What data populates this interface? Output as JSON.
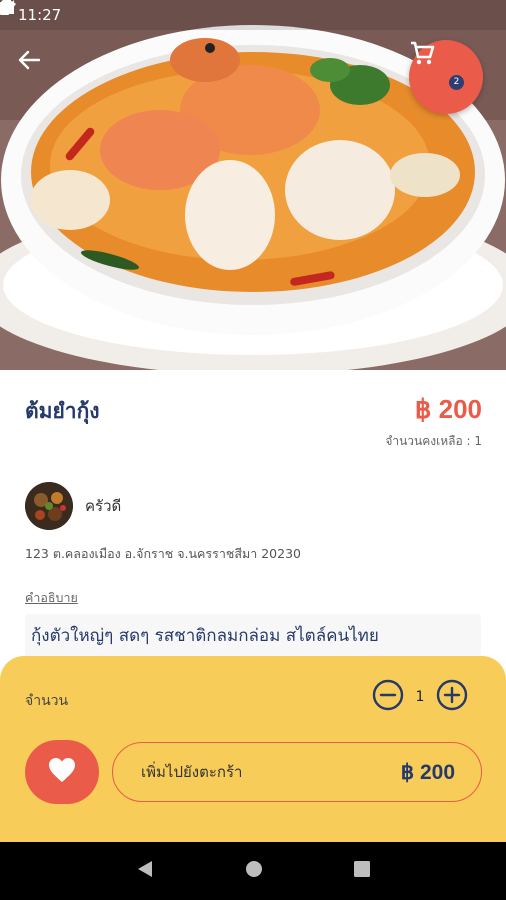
{
  "status_bar": {
    "time": "11:27",
    "icons": [
      "gear-icon",
      "shield-icon",
      "sd-card-icon",
      "wifi-icon",
      "signal-icon",
      "battery-icon"
    ]
  },
  "header": {
    "back_icon": "arrow-left-icon",
    "cart_icon": "shopping-cart-icon",
    "cart_count": "2",
    "accent_color": "#ea5b4a"
  },
  "product": {
    "name": "ต้มยำกุ้ง",
    "price": "฿ 200",
    "stock_text": "จำนวนคงเหลือ : 1"
  },
  "shop": {
    "name": "ครัวดี",
    "address": "123 ต.คลองเมือง อ.จักราช จ.นครราชสีมา 20230"
  },
  "description": {
    "label": "คำอธิบาย",
    "text": "กุ้งตัวใหญ่ๆ สดๆ รสชาติกลมกล่อม สไตล์คนไทย"
  },
  "order_panel": {
    "quantity_label": "จำนวน",
    "quantity_value": "1",
    "add_to_cart_label": "เพิ่มไปยังตะกร้า",
    "add_to_cart_price": "฿ 200",
    "panel_color": "#f8cc58"
  },
  "nav_bar": {
    "icons": [
      "back-triangle-icon",
      "home-circle-icon",
      "recents-square-icon"
    ]
  }
}
